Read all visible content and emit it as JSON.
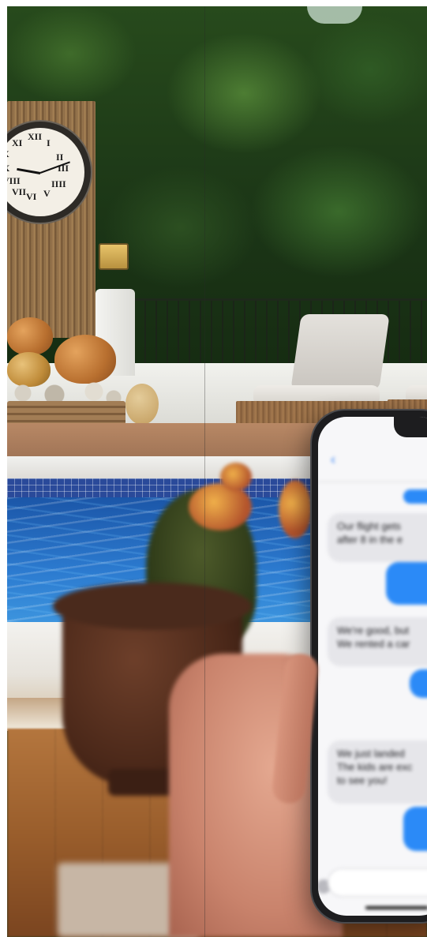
{
  "photo": {
    "subject": "",
    "clock": {
      "numerals": [
        "XII",
        "I",
        "II",
        "III",
        "IIII",
        "V",
        "VI",
        "VII",
        "VIII",
        "IX",
        "X",
        "XI"
      ]
    },
    "phone": {
      "status_time": "",
      "messages": [
        {
          "direction": "in",
          "text": "Our flight gets"
        },
        {
          "direction": "in",
          "text": "after 8 in the e"
        },
        {
          "direction": "out",
          "text": ""
        },
        {
          "direction": "in",
          "text": "We're good, but"
        },
        {
          "direction": "in",
          "text": "We rented a car"
        },
        {
          "direction": "out",
          "text": ""
        },
        {
          "direction": "in",
          "text": "We just landed"
        },
        {
          "direction": "in",
          "text": "The kids are exc"
        },
        {
          "direction": "in",
          "text": "to see you!"
        },
        {
          "direction": "out",
          "text": ""
        }
      ]
    },
    "colors": {
      "pool": "#2c7bd0",
      "imessage_blue": "#2b8af7",
      "bubble_gray": "#e6e6ea",
      "foliage": "#274a1c"
    }
  }
}
